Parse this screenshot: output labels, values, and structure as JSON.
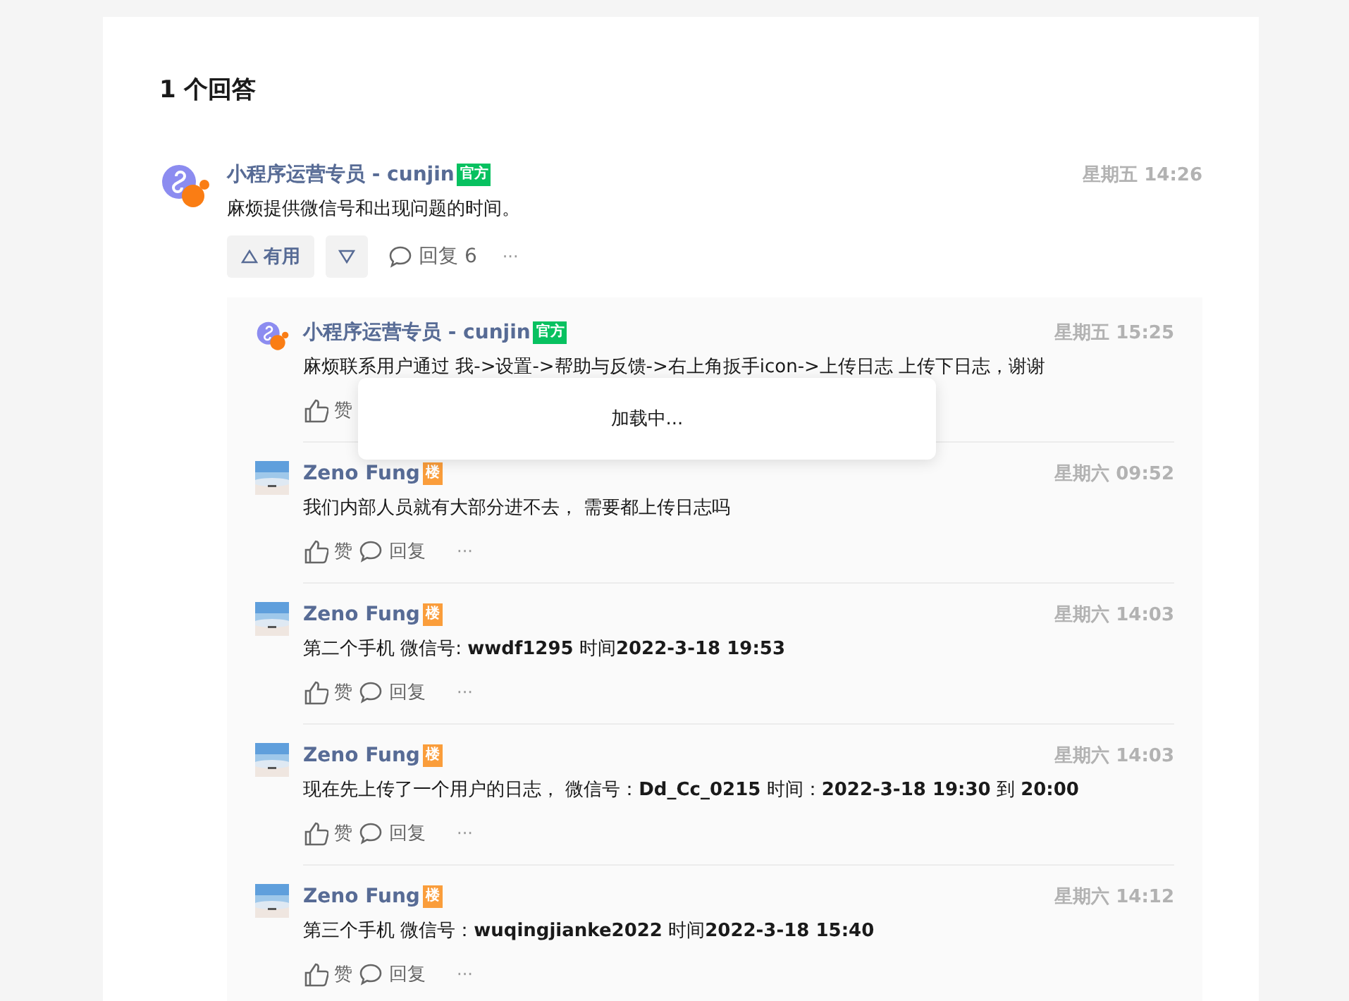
{
  "answers_title": "1 个回答",
  "answer": {
    "author": "小程序运营专员 - cunjin",
    "badge": "官方",
    "time": "星期五 14:26",
    "text": "麻烦提供微信号和出现问题的时间。",
    "useful_label": "有用",
    "reply_label": "回复 6",
    "more": "···"
  },
  "replies": [
    {
      "author": "小程序运营专员 - cunjin",
      "badge": "官方",
      "kind": "official",
      "time": "星期五 15:25",
      "text": "麻烦联系用户通过 我->设置->帮助与反馈->右上角扳手icon->上传日志 上传下日志，谢谢",
      "like_label": "赞"
    },
    {
      "author": "Zeno Fung",
      "badge": "楼",
      "kind": "op",
      "time": "星期六 09:52",
      "text": "我们内部人员就有大部分进不去，  需要都上传日志吗",
      "like_label": "赞",
      "reply_label": "回复",
      "more": "···"
    },
    {
      "author": "Zeno Fung",
      "badge": "楼",
      "kind": "op",
      "time": "星期六 14:03",
      "text": "第二个手机  微信号: **wwdf1295** 时间**2022-3-18  19:53**",
      "like_label": "赞",
      "reply_label": "回复",
      "more": "···"
    },
    {
      "author": "Zeno Fung",
      "badge": "楼",
      "kind": "op",
      "time": "星期六 14:03",
      "text": "现在先上传了一个用户的日志，  微信号：**Dd_Cc_0215** 时间：**2022-3-18 19:30** 到 **20:00**",
      "like_label": "赞",
      "reply_label": "回复",
      "more": "···"
    },
    {
      "author": "Zeno Fung",
      "badge": "楼",
      "kind": "op",
      "time": "星期六 14:12",
      "text": "第三个手机 微信号：**wuqingjianke2022** 时间**2022-3-18 15:40**",
      "like_label": "赞",
      "reply_label": "回复",
      "more": "···"
    }
  ],
  "toast": {
    "text": "加载中..."
  }
}
